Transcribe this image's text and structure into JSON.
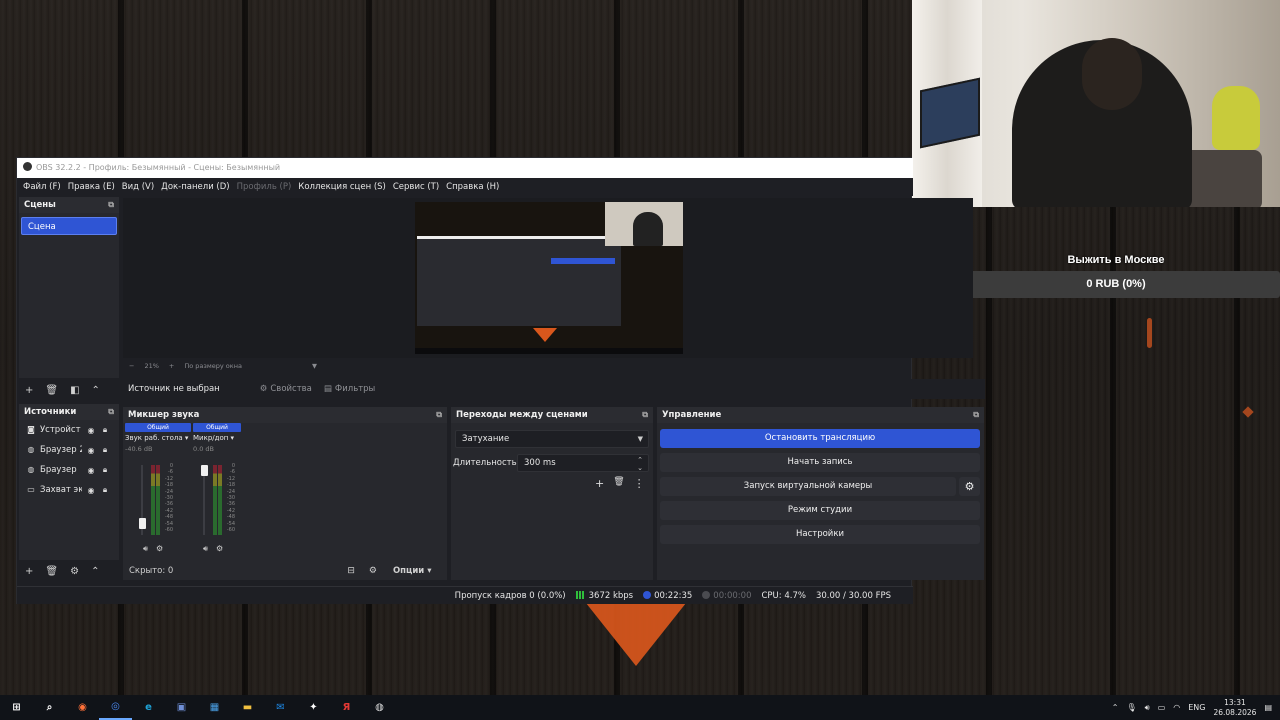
{
  "obs": {
    "title": "OBS 32.2.2 - Профиль: Безымянный - Сцены: Безымянный",
    "menu": [
      {
        "label": "Файл (F)",
        "disabled": false
      },
      {
        "label": "Правка (E)",
        "disabled": false
      },
      {
        "label": "Вид (V)",
        "disabled": false
      },
      {
        "label": "Док-панели (D)",
        "disabled": false
      },
      {
        "label": "Профиль (P)",
        "disabled": true
      },
      {
        "label": "Коллекция сцен (S)",
        "disabled": false
      },
      {
        "label": "Сервис (T)",
        "disabled": false
      },
      {
        "label": "Справка (H)",
        "disabled": false
      }
    ],
    "scenes": {
      "title": "Сцены",
      "items": [
        "Сцена"
      ]
    },
    "preview": {
      "zoom": "21%",
      "fit": "По размеру окна"
    },
    "context": {
      "no_source": "Источник не выбран",
      "properties": "Свойства",
      "filters": "Фильтры"
    },
    "sources": {
      "title": "Источники",
      "items": [
        {
          "name": "Устройст",
          "icon": "camera-icon"
        },
        {
          "name": "Браузер 2",
          "icon": "globe-icon"
        },
        {
          "name": "Браузер",
          "icon": "globe-icon"
        },
        {
          "name": "Захват эк",
          "icon": "monitor-icon"
        }
      ]
    },
    "mixer": {
      "title": "Микшер звука",
      "hidden_label": "Скрыто: 0",
      "options_label": "Опции",
      "channels": [
        {
          "badge": "Общий",
          "name": "Звук раб. стола",
          "db": "-40.6 dB",
          "volume": 0.15
        },
        {
          "badge": "Общий",
          "name": "Микр/доп",
          "db": "0.0 dB",
          "volume": 1.0
        }
      ],
      "scale": [
        "0",
        "-6",
        "-12",
        "-18",
        "-24",
        "-30",
        "-36",
        "-42",
        "-48",
        "-54",
        "-60"
      ]
    },
    "transitions": {
      "title": "Переходы между сценами",
      "type": "Затухание",
      "duration_label": "Длительность",
      "duration_value": "300 ms"
    },
    "controls": {
      "title": "Управление",
      "stop_stream": "Остановить трансляцию",
      "start_recording": "Начать запись",
      "virtual_camera": "Запуск виртуальной камеры",
      "studio_mode": "Режим студии",
      "settings": "Настройки"
    },
    "status": {
      "dropped": "Пропуск кадров 0 (0.0%)",
      "bitrate": "3672 kbps",
      "stream_time": "00:22:35",
      "record_time": "00:00:00",
      "cpu": "CPU: 4.7%",
      "fps": "30.00 / 30.00 FPS"
    }
  },
  "widget": {
    "title": "Выжить в Москве",
    "amount": "0 RUB (0%)"
  },
  "taskbar": {
    "apps": [
      {
        "icon": "windows-start-icon",
        "glyph": "⊞",
        "color": "#ffffff"
      },
      {
        "icon": "search-icon",
        "glyph": "⌕",
        "color": "#ffffff"
      },
      {
        "icon": "firefox-icon",
        "glyph": "◉",
        "color": "#ff7139"
      },
      {
        "icon": "chrome-icon",
        "glyph": "◎",
        "color": "#4c8bf5"
      },
      {
        "icon": "edge-icon",
        "glyph": "e",
        "color": "#1ea2d6"
      },
      {
        "icon": "save-icon",
        "glyph": "▣",
        "color": "#6f8fd6"
      },
      {
        "icon": "store-icon",
        "glyph": "▦",
        "color": "#4aa0e6"
      },
      {
        "icon": "folder-icon",
        "glyph": "▬",
        "color": "#f0c040"
      },
      {
        "icon": "mail-icon",
        "glyph": "✉",
        "color": "#1e88e5"
      },
      {
        "icon": "sparkle-icon",
        "glyph": "✦",
        "color": "#ffffff"
      },
      {
        "icon": "yandex-icon",
        "glyph": "Я",
        "color": "#e53935"
      },
      {
        "icon": "obs-icon",
        "glyph": "◍",
        "color": "#dddddd"
      }
    ],
    "lang": "ENG",
    "time": "13:31",
    "date": "26.08.2026"
  }
}
